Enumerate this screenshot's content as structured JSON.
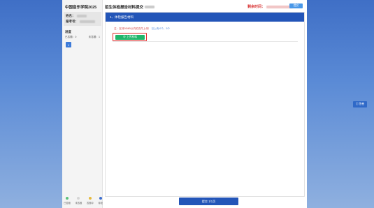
{
  "app": {
    "name": "中国音乐学院2025",
    "page_title": "招生体检报告材料提交"
  },
  "candidate": {
    "name_label": "姓名：",
    "id_label": "报考号："
  },
  "progress": {
    "title": "进度",
    "answered_label": "已答题：0",
    "unanswered_label": "未答题：1",
    "question_numbers": [
      "1"
    ]
  },
  "legend": [
    {
      "label": "已答题",
      "color": "#5cc27b"
    },
    {
      "label": "未答题",
      "color": "#d6d6d6"
    },
    {
      "label": "答题中",
      "color": "#e5b93c"
    },
    {
      "label": "待检",
      "color": "#3d6ed0"
    }
  ],
  "header": {
    "countdown_label": "剩余时间：",
    "top_button_label": "提交"
  },
  "section": {
    "header": "1、体检报告材料",
    "notice_prefix": "注：支持20MB以内的文件上传！",
    "notice_hint": "已上传:0个，5个",
    "upload_button_label": "⊕ 上传材料"
  },
  "footer": {
    "submit_label": "提交 1/1页"
  },
  "side": {
    "button_label": "▤ 答卷"
  }
}
